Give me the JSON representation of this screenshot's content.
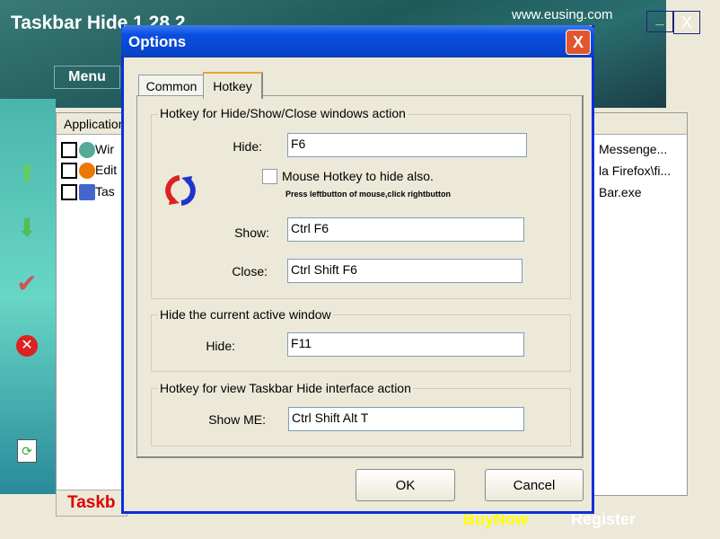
{
  "app": {
    "title": "Taskbar Hide 1.28.2",
    "website": "www.eusing.com",
    "minimize": "_",
    "close": "X",
    "menu": "Menu",
    "list_header": "Application",
    "rows": [
      {
        "name": "Wir",
        "path": "Messenge..."
      },
      {
        "name": "Edit",
        "path": "la Firefox\\fi..."
      },
      {
        "name": "Tas",
        "path": "Bar.exe"
      }
    ],
    "status": "Taskb",
    "buy_now": "BuyNow",
    "register": "Register"
  },
  "dialog": {
    "title": "Options",
    "close": "X",
    "tabs": [
      {
        "label": "Common"
      },
      {
        "label": "Hotkey"
      }
    ],
    "group1": {
      "title": "Hotkey for Hide/Show/Close windows action",
      "hide_label": "Hide:",
      "hide_value": "F6",
      "mouse_label": "Mouse Hotkey to hide also.",
      "mouse_hint": "Press leftbutton of mouse,click rightbutton",
      "show_label": "Show:",
      "show_value": "Ctrl  F6",
      "close_label": "Close:",
      "close_value": "Ctrl  Shift  F6"
    },
    "group2": {
      "title": "Hide the current active window",
      "hide_label": "Hide:",
      "hide_value": "F11"
    },
    "group3": {
      "title": "Hotkey for view Taskbar Hide interface action",
      "show_label": "Show ME:",
      "show_value": "Ctrl  Shift  Alt  T"
    },
    "ok": "OK",
    "cancel": "Cancel"
  }
}
